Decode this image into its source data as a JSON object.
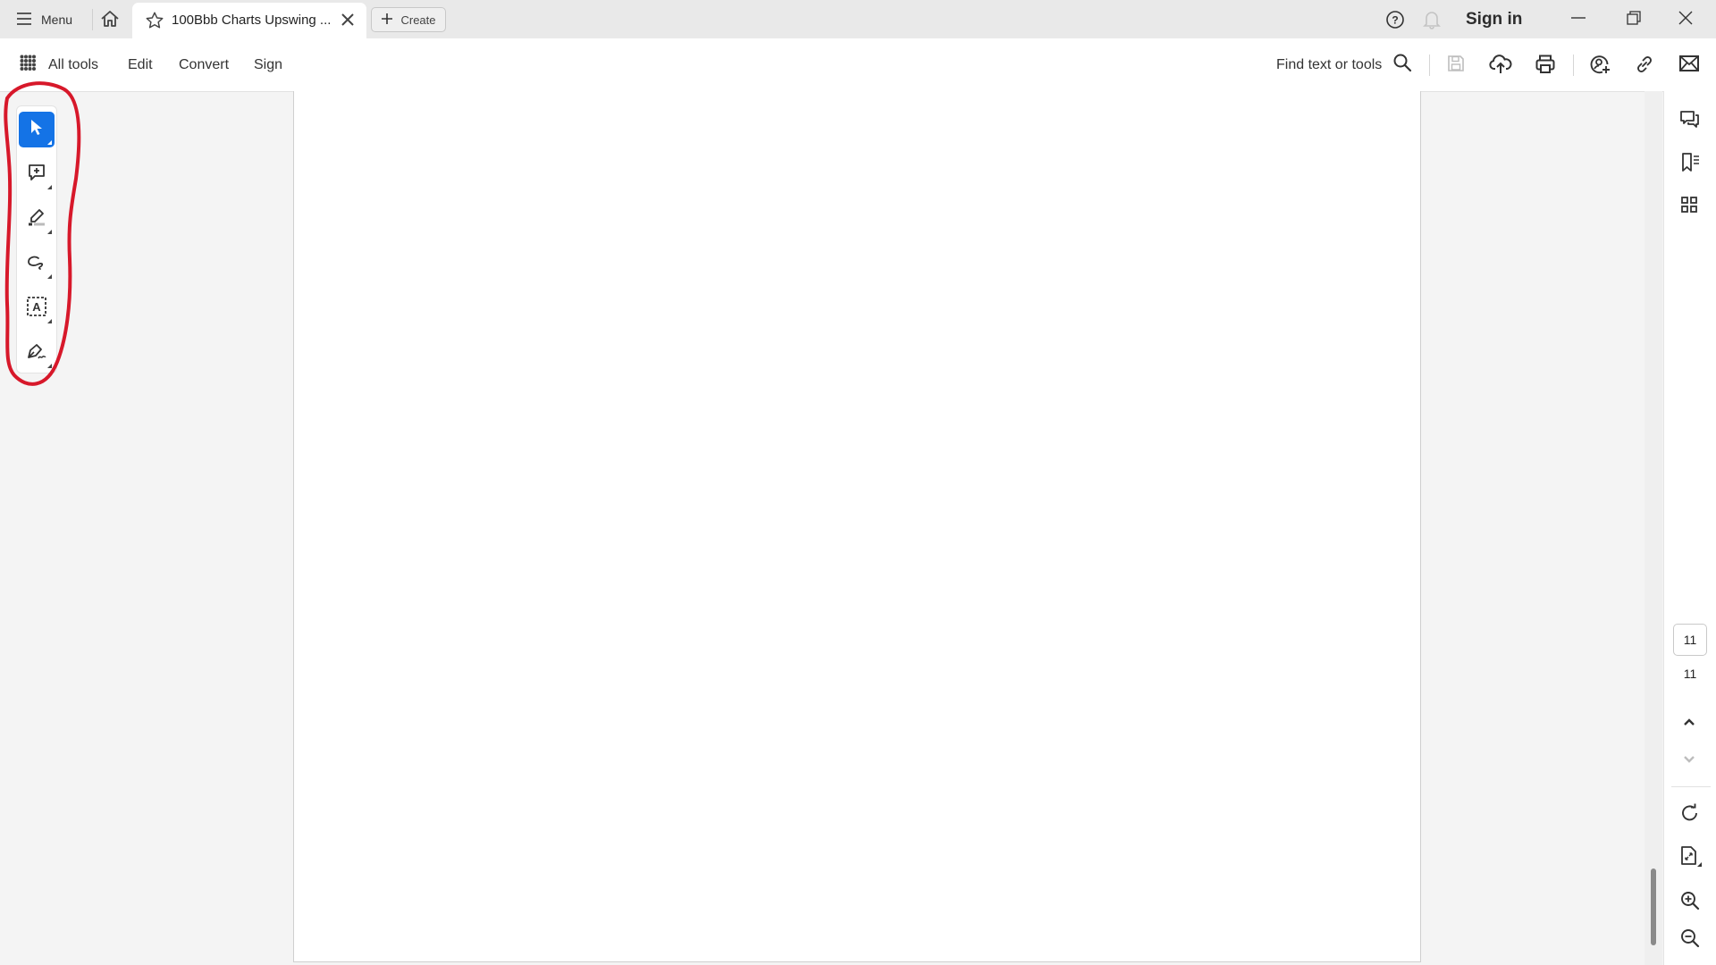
{
  "titlebar": {
    "menu_label": "Menu",
    "tab_title": "100Bbb Charts Upswing ...",
    "create_label": "Create",
    "sign_in_label": "Sign in"
  },
  "toolbar": {
    "all_tools_label": "All tools",
    "edit_label": "Edit",
    "convert_label": "Convert",
    "sign_label": "Sign",
    "find_label": "Find text or tools",
    "icons": [
      "search-icon",
      "save-icon",
      "upload-cloud-icon",
      "print-icon",
      "share-user-icon",
      "link-icon",
      "email-icon"
    ]
  },
  "left_tools": [
    {
      "name": "select-tool",
      "icon": "cursor-arrow-icon",
      "active": true
    },
    {
      "name": "add-comment-tool",
      "icon": "comment-plus-icon",
      "active": false
    },
    {
      "name": "highlight-tool",
      "icon": "highlighter-icon",
      "active": false
    },
    {
      "name": "draw-tool",
      "icon": "freehand-loop-icon",
      "active": false
    },
    {
      "name": "text-box-tool",
      "icon": "text-box-icon",
      "active": false
    },
    {
      "name": "sign-tool",
      "icon": "pen-sign-icon",
      "active": false
    }
  ],
  "right_panel": {
    "top_icons": [
      "comments-icon",
      "bookmark-list-icon",
      "thumbnails-grid-icon"
    ],
    "current_page": "11",
    "total_pages": "11",
    "bottom_icons": [
      "page-up-icon",
      "page-down-icon",
      "rotate-icon",
      "fit-page-icon",
      "zoom-in-icon",
      "zoom-out-icon"
    ]
  },
  "colors": {
    "accent": "#1473e6",
    "annotation_red": "#d7182a"
  }
}
